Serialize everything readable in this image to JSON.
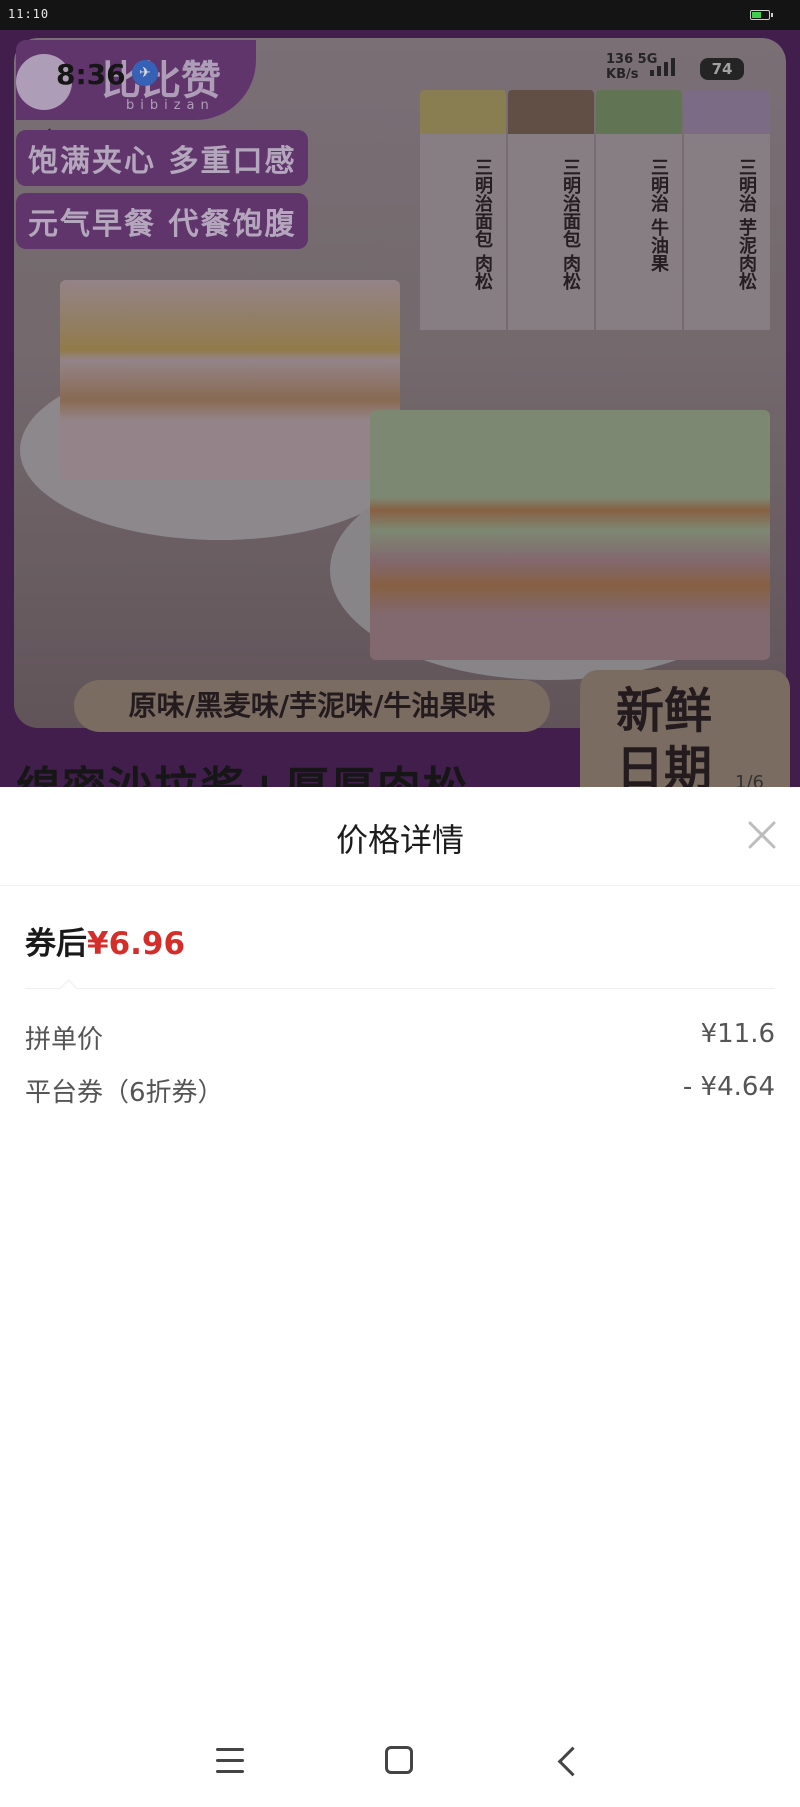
{
  "system_status": {
    "time": "11:10"
  },
  "product_image": {
    "brand": "比比赞",
    "brand_sub": "bibizan",
    "inner_time": "8:36",
    "inner_net_speed": "136",
    "inner_net_unit": "KB/s",
    "inner_net_type": "5G",
    "inner_battery": "74",
    "badge_line1": "饱满夹心 多重口感",
    "badge_line2": "元气早餐 代餐饱腹",
    "packages": [
      {
        "name": "三明治面包 肉松",
        "color": "#9c8f5e"
      },
      {
        "name": "三明治面包 肉松",
        "color": "#6f5a4f"
      },
      {
        "name": "三明治 牛油果",
        "color": "#6f8660"
      },
      {
        "name": "三明治 芋泥肉松",
        "color": "#8d7a97"
      }
    ],
    "flavors": "原味/黑麦味/芋泥味/牛油果味",
    "fresh_label": "新鲜日期",
    "slogan": "绵密沙拉酱+厚厚肉松",
    "page_indicator": "1/6"
  },
  "price_sheet": {
    "title": "价格详情",
    "after_coupon_label": "券后",
    "after_coupon_price": "¥6.96",
    "rows": [
      {
        "label": "拼单价",
        "value": "¥11.6"
      },
      {
        "label": "平台券（6折券）",
        "value": "- ¥4.64"
      }
    ]
  },
  "colors": {
    "accent_price": "#d42d2a",
    "brand_purple": "#6e3d7b"
  },
  "icons": {
    "close": "close-icon",
    "back": "back-arrow-icon",
    "share": "share-icon",
    "menu": "menu-icon",
    "home": "home-icon",
    "nav_back": "back-icon"
  }
}
